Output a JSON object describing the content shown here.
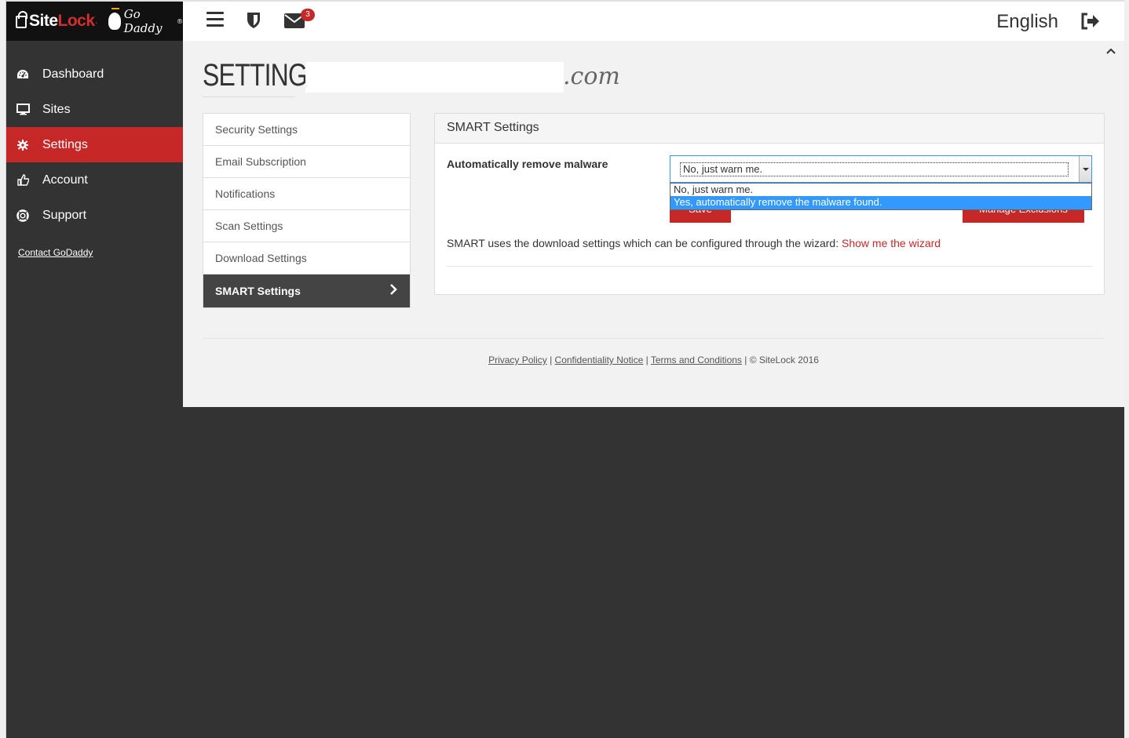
{
  "brand": {
    "sitelock_site": "Site",
    "sitelock_lock": "Lock",
    "sitelock_tm": ".",
    "godaddy": "Go Daddy",
    "godaddy_tm": "®"
  },
  "sidebar": {
    "items": [
      {
        "label": "Dashboard",
        "icon": "dashboard-icon"
      },
      {
        "label": "Sites",
        "icon": "monitor-icon"
      },
      {
        "label": "Settings",
        "icon": "gear-icon",
        "active": true
      },
      {
        "label": "Account",
        "icon": "thumbs-up-icon"
      },
      {
        "label": "Support",
        "icon": "lifebuoy-icon"
      }
    ],
    "contact": "Contact GoDaddy"
  },
  "topbar": {
    "mail_count": "3",
    "language": "English"
  },
  "page": {
    "title": "SETTINGS",
    "domain_tld": ".com"
  },
  "settings_menu": {
    "items": [
      {
        "label": "Security Settings"
      },
      {
        "label": "Email Subscription"
      },
      {
        "label": "Notifications"
      },
      {
        "label": "Scan Settings"
      },
      {
        "label": "Download Settings"
      },
      {
        "label": "SMART Settings",
        "active": true
      }
    ]
  },
  "panel": {
    "title": "SMART Settings",
    "field_label": "Automatically remove malware",
    "select_value": "No, just warn me.",
    "options": [
      "No, just warn me.",
      "Yes, automatically remove the malware found."
    ],
    "save_label": "Save",
    "exclusions_label": "Manage Exclusions",
    "info_text": "SMART uses the download settings which can be configured through the wizard:",
    "wizard_link": "Show me the wizard"
  },
  "footer": {
    "privacy": "Privacy Policy",
    "sep1": " | ",
    "confidentiality": "Confidentiality Notice",
    "sep2": " | ",
    "terms": "Terms and Conditions",
    "copyright": " | © SiteLock 2016"
  },
  "colors": {
    "accent": "#c62828",
    "sidebar_bg": "#333333",
    "selection": "#3399ff"
  }
}
